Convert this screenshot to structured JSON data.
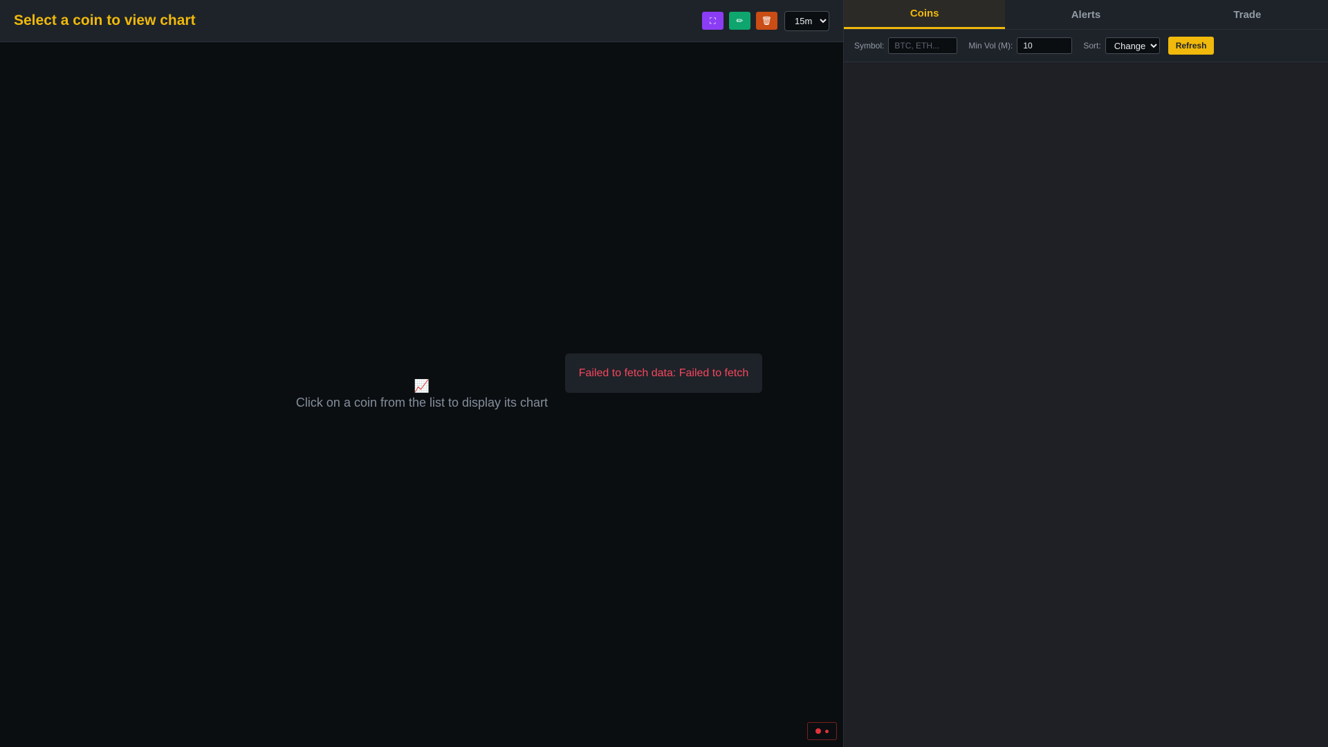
{
  "header": {
    "title": "Select a coin to view chart",
    "tools": {
      "fullscreen_icon": "⛶",
      "draw_icon": "✏",
      "delete_icon": "🗑"
    },
    "timeframe": {
      "selected": "15m"
    }
  },
  "chart": {
    "empty_icon": "📈",
    "empty_message": "Click on a coin from the list to display its chart"
  },
  "toast": {
    "message": "Failed to fetch data: Failed to fetch"
  },
  "status": {
    "color": "#e3323c"
  },
  "tabs": [
    {
      "label": "Coins"
    },
    {
      "label": "Alerts"
    },
    {
      "label": "Trade"
    }
  ],
  "filters": {
    "symbol_label": "Symbol:",
    "symbol_placeholder": "BTC, ETH...",
    "minvol_label": "Min Vol (M):",
    "minvol_value": "10",
    "sort_label": "Sort:",
    "sort_selected": "Change",
    "refresh_label": "Refresh"
  },
  "colors": {
    "accent": "#f0b90b",
    "error": "#f6465d",
    "background": "#0b0e11",
    "panel": "#1e2329"
  }
}
